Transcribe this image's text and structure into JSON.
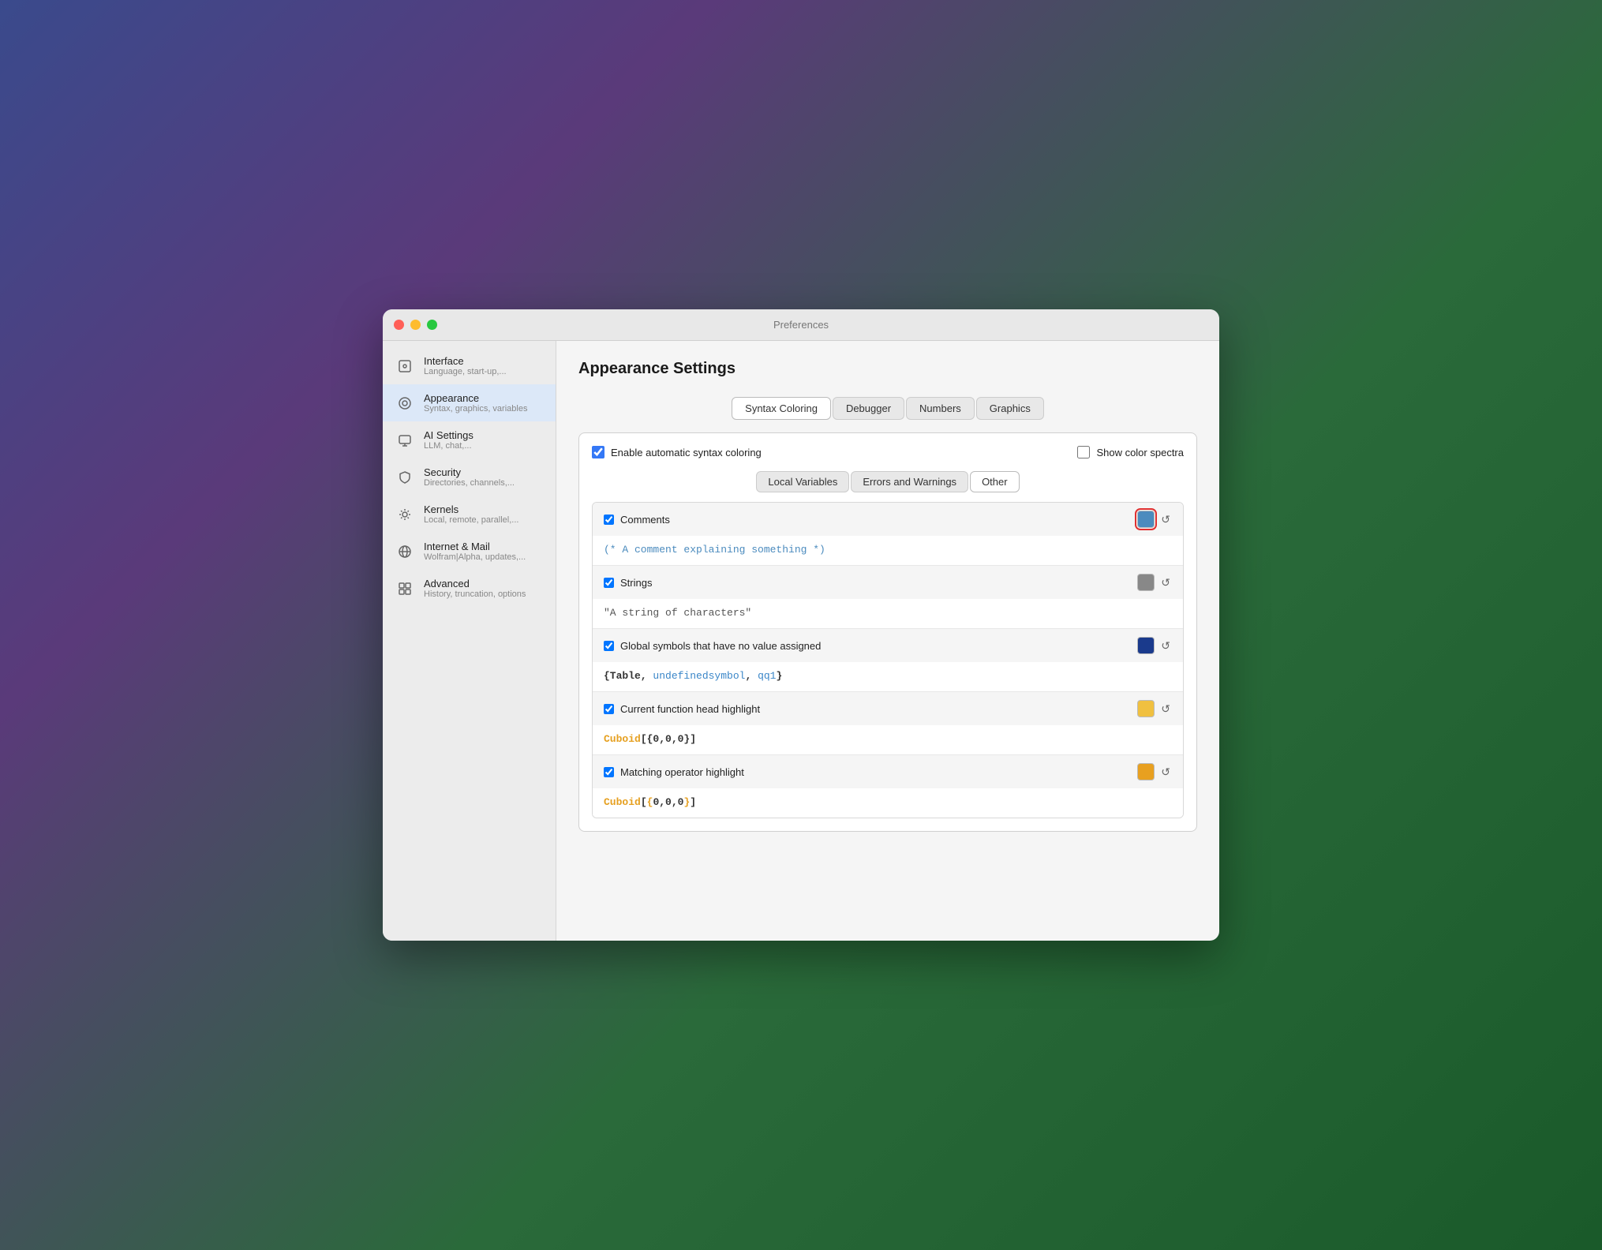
{
  "window": {
    "title": "Preferences"
  },
  "sidebar": {
    "items": [
      {
        "id": "interface",
        "label": "Interface",
        "sublabel": "Language, start-up,...",
        "icon": "⊞"
      },
      {
        "id": "appearance",
        "label": "Appearance",
        "sublabel": "Syntax, graphics, variables",
        "icon": "◎",
        "active": true
      },
      {
        "id": "ai",
        "label": "AI Settings",
        "sublabel": "LLM, chat,...",
        "icon": "💬"
      },
      {
        "id": "security",
        "label": "Security",
        "sublabel": "Directories, channels,...",
        "icon": "🔒"
      },
      {
        "id": "kernels",
        "label": "Kernels",
        "sublabel": "Local, remote, parallel,...",
        "icon": "⚙"
      },
      {
        "id": "internet",
        "label": "Internet & Mail",
        "sublabel": "Wolfram|Alpha, updates,...",
        "icon": "🌐"
      },
      {
        "id": "advanced",
        "label": "Advanced",
        "sublabel": "History, truncation, options",
        "icon": "▦"
      }
    ]
  },
  "main": {
    "page_title": "Appearance Settings",
    "tabs": [
      {
        "id": "syntax",
        "label": "Syntax Coloring",
        "active": true
      },
      {
        "id": "debugger",
        "label": "Debugger"
      },
      {
        "id": "numbers",
        "label": "Numbers"
      },
      {
        "id": "graphics",
        "label": "Graphics"
      }
    ],
    "enable_syntax_label": "Enable automatic syntax coloring",
    "show_spectra_label": "Show color spectra",
    "sub_tabs": [
      {
        "id": "local",
        "label": "Local Variables"
      },
      {
        "id": "errors",
        "label": "Errors and Warnings"
      },
      {
        "id": "other",
        "label": "Other",
        "active": true
      }
    ],
    "color_items": [
      {
        "id": "comments",
        "label": "Comments",
        "checked": true,
        "swatch_color": "#4b8bbe",
        "selected": true,
        "preview_type": "comment",
        "preview_text": "(* A comment explaining something *)"
      },
      {
        "id": "strings",
        "label": "Strings",
        "checked": true,
        "swatch_color": "#888888",
        "selected": false,
        "preview_type": "string",
        "preview_text": "\"A string of characters\""
      },
      {
        "id": "global",
        "label": "Global symbols that have no value assigned",
        "checked": true,
        "swatch_color": "#1a3a8c",
        "selected": false,
        "preview_type": "global",
        "preview_text": "{Table, undefinedsymbol, qq1}"
      },
      {
        "id": "fn_head",
        "label": "Current function head highlight",
        "checked": true,
        "swatch_color": "#f0c040",
        "selected": false,
        "preview_type": "fn_head",
        "preview_text": "Cuboid[{0,0,0}]"
      },
      {
        "id": "matching",
        "label": "Matching operator highlight",
        "checked": true,
        "swatch_color": "#e8a020",
        "selected": false,
        "preview_type": "matching",
        "preview_text": "Cuboid[{0,0,0}]"
      }
    ]
  }
}
